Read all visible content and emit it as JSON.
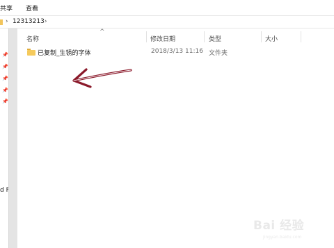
{
  "ribbon": {
    "tabs": [
      "共享",
      "查看"
    ]
  },
  "address": {
    "separator": "›",
    "folder": "12313213",
    "trailing_separator": "›"
  },
  "nav": {
    "pin_icon": "📌",
    "clipped_text": "d F"
  },
  "columns": {
    "sort_indicator": "^",
    "name": "名称",
    "date": "修改日期",
    "type": "类型",
    "size": "大小"
  },
  "files": [
    {
      "name": "已复制_生锈的字体",
      "date": "2018/3/13 11:16",
      "type": "文件夹",
      "size": ""
    }
  ],
  "annotation": {
    "icon": "arrow-left",
    "color": "#8b1a2b"
  },
  "watermark": {
    "text": "Bai 经验",
    "sub": "jingyan.baidu.com"
  }
}
